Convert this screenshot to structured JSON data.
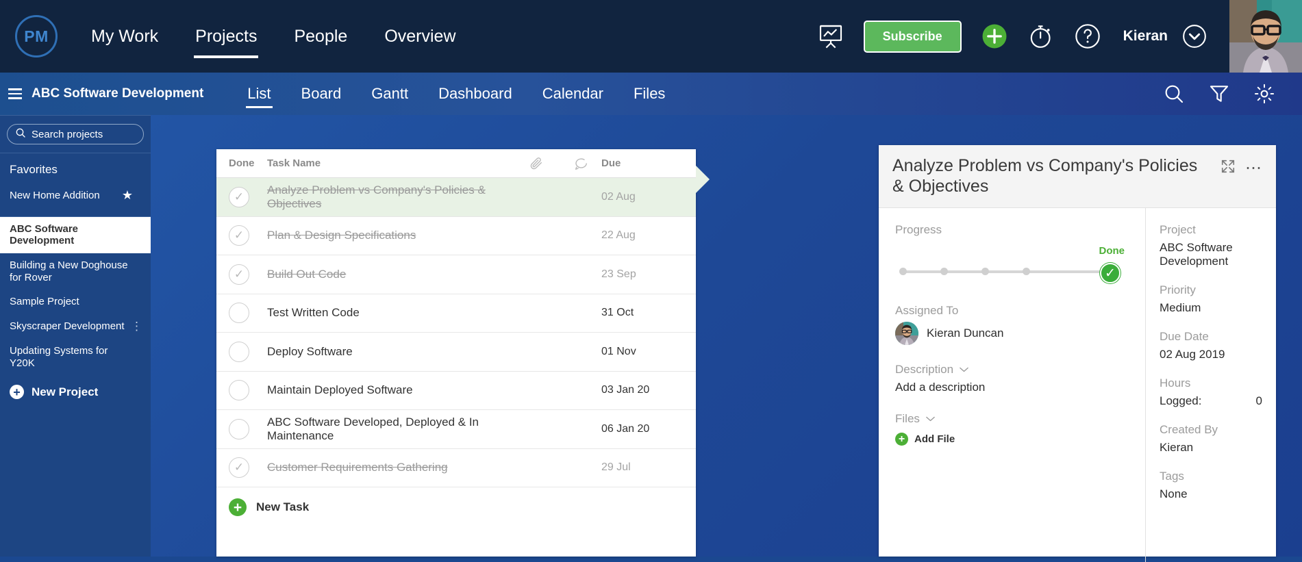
{
  "header": {
    "logo_text": "PM",
    "nav": [
      {
        "label": "My Work",
        "active": false
      },
      {
        "label": "Projects",
        "active": true
      },
      {
        "label": "People",
        "active": false
      },
      {
        "label": "Overview",
        "active": false
      }
    ],
    "chart_icon": "presentation-chart-icon",
    "subscribe_label": "Subscribe",
    "add_icon": "plus-circle-icon",
    "timer_icon": "stopwatch-icon",
    "help_icon": "question-circle-icon",
    "username": "Kieran",
    "caret_icon": "chevron-down-circle-icon"
  },
  "subnav": {
    "project_name": "ABC Software Development",
    "menu_icon": "hamburger-icon",
    "tabs": [
      {
        "label": "List",
        "active": true
      },
      {
        "label": "Board",
        "active": false
      },
      {
        "label": "Gantt",
        "active": false
      },
      {
        "label": "Dashboard",
        "active": false
      },
      {
        "label": "Calendar",
        "active": false
      },
      {
        "label": "Files",
        "active": false
      }
    ],
    "search_icon": "search-icon",
    "filter_icon": "funnel-filter-icon",
    "settings_icon": "gear-icon"
  },
  "sidebar": {
    "search_placeholder": "Search projects",
    "search_icon": "search-icon",
    "favorites_heading": "Favorites",
    "favorite": {
      "label": "New Home Addition",
      "star_icon": "star-icon"
    },
    "projects": [
      {
        "label": "ABC Software Development",
        "current": true,
        "menu": false
      },
      {
        "label": "Building a New Doghouse for Rover",
        "current": false,
        "menu": false
      },
      {
        "label": "Sample Project",
        "current": false,
        "menu": false
      },
      {
        "label": "Skyscraper Development",
        "current": false,
        "menu": true
      },
      {
        "label": "Updating Systems for Y20K",
        "current": false,
        "menu": false
      }
    ],
    "new_project_label": "New Project",
    "new_project_icon": "plus-circle-icon"
  },
  "task_list": {
    "columns": {
      "done": "Done",
      "name": "Task Name",
      "attachment_icon": "paperclip-icon",
      "comment_icon": "comment-bubble-icon",
      "due": "Due"
    },
    "rows": [
      {
        "name": "Analyze Problem vs Company's Policies & Objectives",
        "due": "02 Aug",
        "done": true,
        "selected": true
      },
      {
        "name": "Plan & Design Specifications",
        "due": "22 Aug",
        "done": true,
        "selected": false
      },
      {
        "name": "Build Out Code",
        "due": "23 Sep",
        "done": true,
        "selected": false
      },
      {
        "name": "Test Written Code",
        "due": "31 Oct",
        "done": false,
        "selected": false
      },
      {
        "name": "Deploy Software",
        "due": "01 Nov",
        "done": false,
        "selected": false
      },
      {
        "name": "Maintain Deployed Software",
        "due": "03 Jan 20",
        "done": false,
        "selected": false
      },
      {
        "name": "ABC Software Developed, Deployed & In Maintenance",
        "due": "06 Jan 20",
        "done": false,
        "selected": false
      },
      {
        "name": "Customer Requirements Gathering",
        "due": "29 Jul",
        "done": true,
        "selected": false
      }
    ],
    "new_task_label": "New Task",
    "new_task_icon": "plus-circle-icon"
  },
  "detail": {
    "title": "Analyze Problem vs Company's Policies & Objectives",
    "expand_icon": "expand-arrows-icon",
    "more_icon": "ellipsis-horizontal-icon",
    "progress_label": "Progress",
    "progress_done_label": "Done",
    "progress_steps": 5,
    "progress_value": 100,
    "assigned_label": "Assigned To",
    "assignee_name": "Kieran Duncan",
    "assignee_avatar": "user-avatar",
    "description_label": "Description",
    "description_value": "Add a description",
    "files_label": "Files",
    "add_file_label": "Add File",
    "add_file_icon": "plus-circle-icon",
    "caret_icon": "chevron-down-icon",
    "meta": {
      "project_label": "Project",
      "project_value": "ABC Software Development",
      "priority_label": "Priority",
      "priority_value": "Medium",
      "due_label": "Due Date",
      "due_value": "02 Aug 2019",
      "hours_label": "Hours",
      "hours_logged_label": "Logged:",
      "hours_logged_value": "0",
      "created_by_label": "Created By",
      "created_by_value": "Kieran",
      "tags_label": "Tags",
      "tags_value": "None"
    }
  },
  "colors": {
    "brand_dark": "#11243f",
    "brand_blue": "#1d4583",
    "accent_green": "#5cb85c",
    "selected_row": "#e8f2e5"
  }
}
